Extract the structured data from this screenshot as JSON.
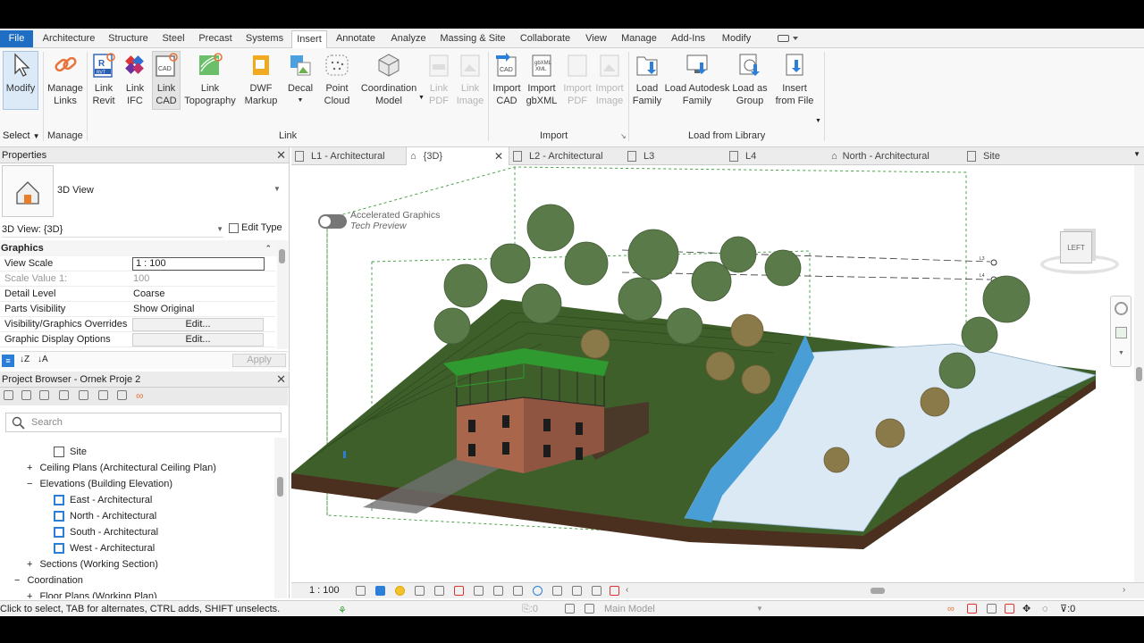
{
  "menu_tabs": [
    "File",
    "Architecture",
    "Structure",
    "Steel",
    "Precast",
    "Systems",
    "Insert",
    "Annotate",
    "Analyze",
    "Massing & Site",
    "Collaborate",
    "View",
    "Manage",
    "Add-Ins",
    "Modify"
  ],
  "ribbon": {
    "modify": "Modify",
    "select": "Select",
    "manage_links": [
      "Manage",
      "Links"
    ],
    "manage_panel": "Manage",
    "link_revit": [
      "Link",
      "Revit"
    ],
    "link_ifc": [
      "Link",
      "IFC"
    ],
    "link_cad": [
      "Link",
      "CAD"
    ],
    "link_topo": [
      "Link",
      "Topography"
    ],
    "dwf": [
      "DWF",
      "Markup"
    ],
    "decal": "Decal",
    "point_cloud": [
      "Point",
      "Cloud"
    ],
    "coord_model": [
      "Coordination",
      "Model"
    ],
    "link_pdf": [
      "Link",
      "PDF"
    ],
    "link_image": [
      "Link",
      "Image"
    ],
    "link_panel": "Link",
    "import_cad": [
      "Import",
      "CAD"
    ],
    "import_gbxml": [
      "Import",
      "gbXML"
    ],
    "import_pdf": [
      "Import",
      "PDF"
    ],
    "import_image": [
      "Import",
      "Image"
    ],
    "import_panel": "Import",
    "load_family": [
      "Load",
      "Family"
    ],
    "load_autodesk": [
      "Load Autodesk",
      "Family"
    ],
    "load_group": [
      "Load as",
      "Group"
    ],
    "insert_file": [
      "Insert",
      "from File"
    ],
    "library_panel": "Load from Library",
    "icon_labels": {
      "rvt": "RVT",
      "cad": "CAD",
      "gbxml": "gbXML",
      "xml": "XML"
    }
  },
  "properties": {
    "title": "Properties",
    "type_name": "3D View",
    "view_selector": "3D View: {3D}",
    "edit_type": "Edit Type",
    "group": "Graphics",
    "rows": [
      {
        "label": "View Scale",
        "value": "1 : 100"
      },
      {
        "label": "Scale Value    1:",
        "value": "100"
      },
      {
        "label": "Detail Level",
        "value": "Coarse"
      },
      {
        "label": "Parts Visibility",
        "value": "Show Original"
      },
      {
        "label": "Visibility/Graphics Overrides",
        "value": "Edit..."
      },
      {
        "label": "Graphic Display Options",
        "value": "Edit..."
      }
    ],
    "apply": "Apply"
  },
  "browser": {
    "title": "Project Browser - Ornek Proje 2",
    "search_placeholder": "Search",
    "items": [
      "Site",
      "Ceiling Plans (Architectural Ceiling Plan)",
      "Elevations (Building Elevation)",
      "East - Architectural",
      "North - Architectural",
      "South - Architectural",
      "West - Architectural",
      "Sections (Working Section)",
      "Coordination",
      "Floor Plans (Working Plan)"
    ]
  },
  "view_tabs": [
    "L1 - Architectural",
    "{3D}",
    "L2 - Architectural",
    "L3",
    "L4",
    "North - Architectural",
    "Site"
  ],
  "canvas": {
    "accel_title": "Accelerated Graphics",
    "accel_sub": "Tech Preview",
    "viewcube_face": "LEFT",
    "level_tag": "L3",
    "level_tag2": "L4"
  },
  "view_scale": "1 : 100",
  "status": {
    "hint": "Click to select, TAB for alternates, CTRL adds, SHIFT unselects.",
    "workset_count": ":0",
    "model": "Main Model",
    "filter_count": ":0"
  },
  "colors": {
    "accent": "#1e6fc4",
    "grass": "#3f5f2a",
    "roof": "#2f9a2f",
    "water": "#4a9ed6",
    "brick": "#a8664c"
  }
}
